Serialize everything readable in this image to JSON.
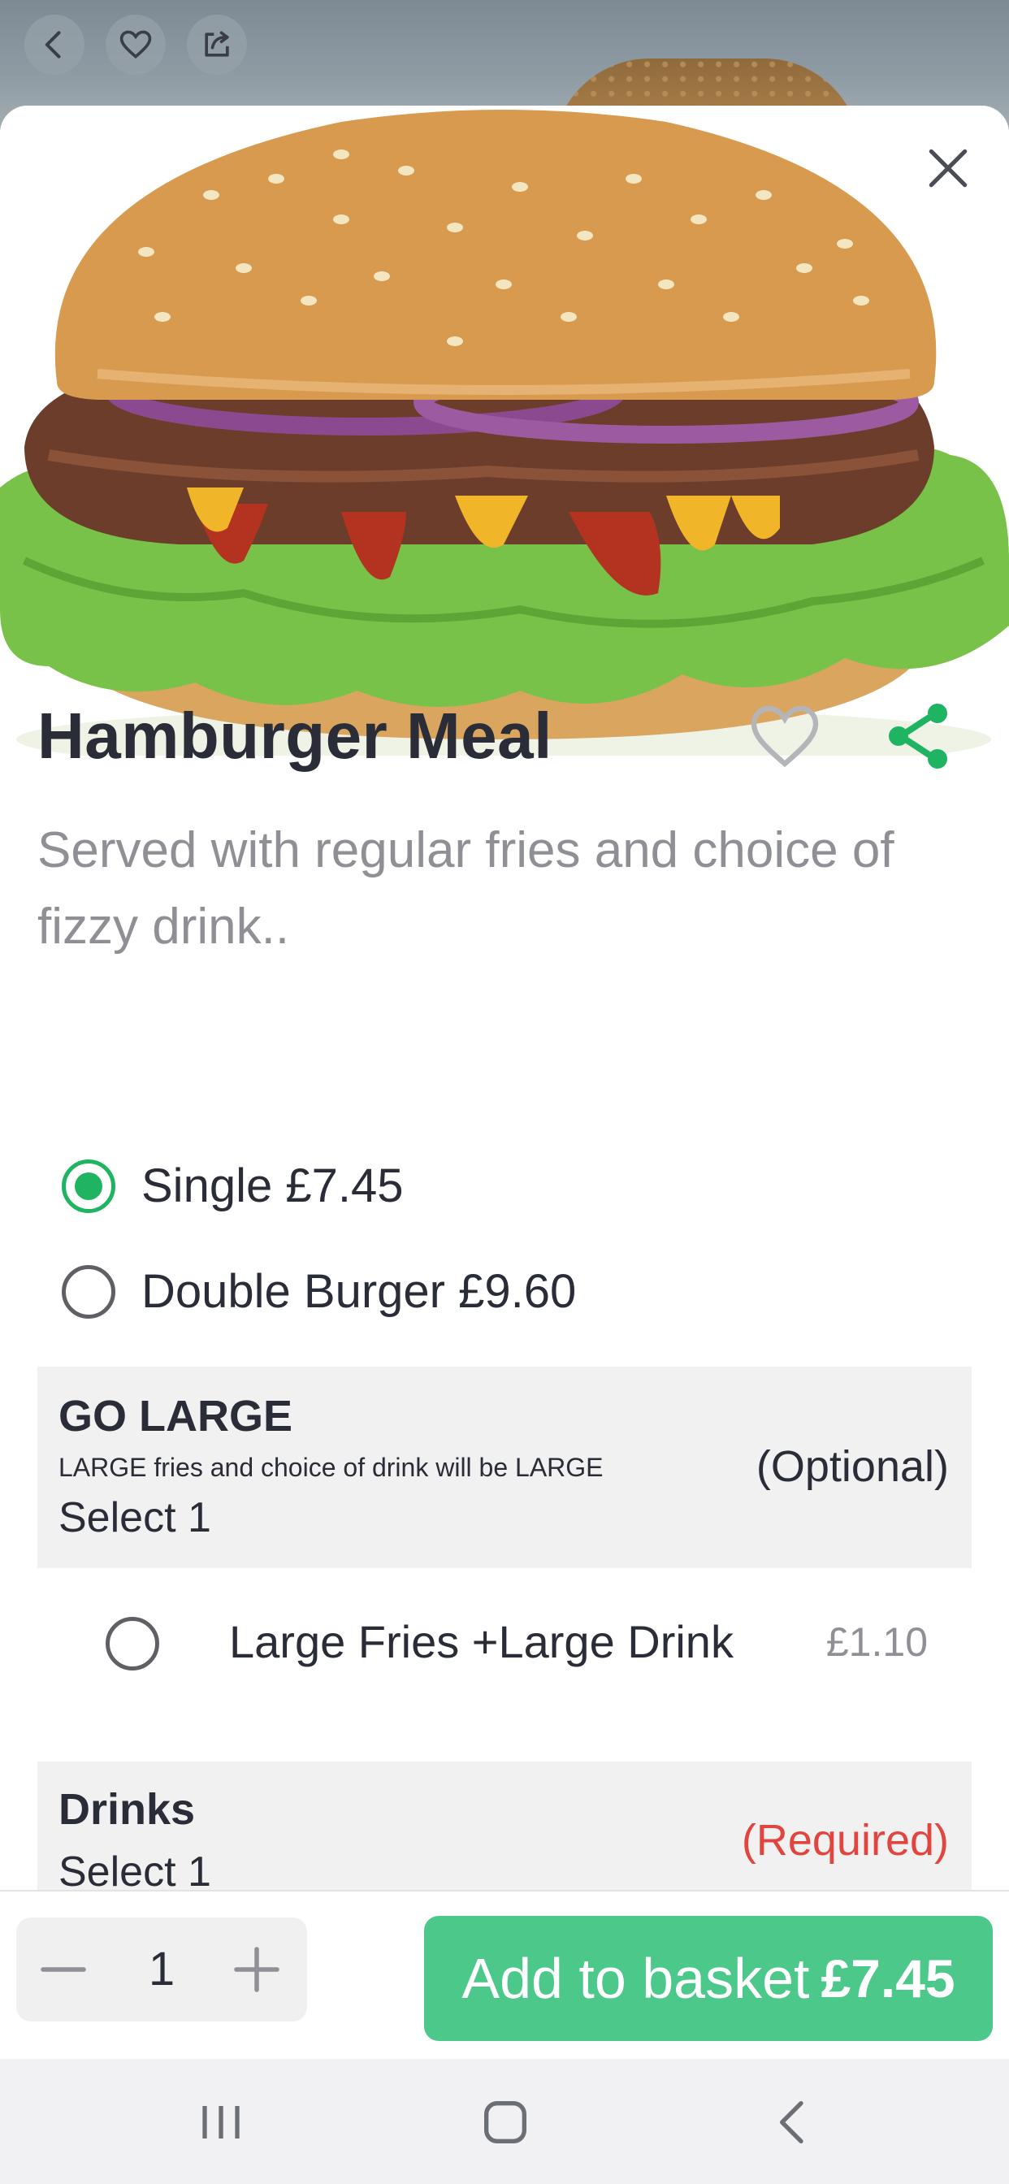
{
  "header": {
    "back_icon": "chevron-left-icon",
    "favorite_icon": "heart-outline-icon",
    "share_icon": "share-box-icon"
  },
  "item": {
    "title": "Hamburger Meal",
    "description": "Served with regular fries and choice of fizzy drink..",
    "favorite_icon": "heart-outline-icon",
    "share_icon": "share-nodes-icon",
    "close_icon": "close-icon"
  },
  "sizes": [
    {
      "label": "Single £7.45",
      "selected": true
    },
    {
      "label": "Double Burger £9.60",
      "selected": false
    }
  ],
  "groups": {
    "go_large": {
      "title": "GO LARGE",
      "subtitle": "LARGE fries and choice of drink will be LARGE",
      "select": "Select 1",
      "tag": "(Optional)",
      "options": [
        {
          "label": "Large Fries +Large Drink",
          "price": "£1.10",
          "selected": false
        }
      ]
    },
    "drinks": {
      "title": "Drinks",
      "select": "Select 1",
      "tag": "(Required)"
    }
  },
  "footer": {
    "quantity": "1",
    "add_label": "Add to basket",
    "add_price": "£7.45"
  },
  "colors": {
    "accent_green": "#1fb461",
    "button_green": "#4cc98a",
    "required_red": "#e0453f",
    "muted_text": "#8f9095"
  },
  "navbar": {
    "recent_icon": "recent-apps-icon",
    "home_icon": "home-icon",
    "back_icon": "back-icon"
  }
}
